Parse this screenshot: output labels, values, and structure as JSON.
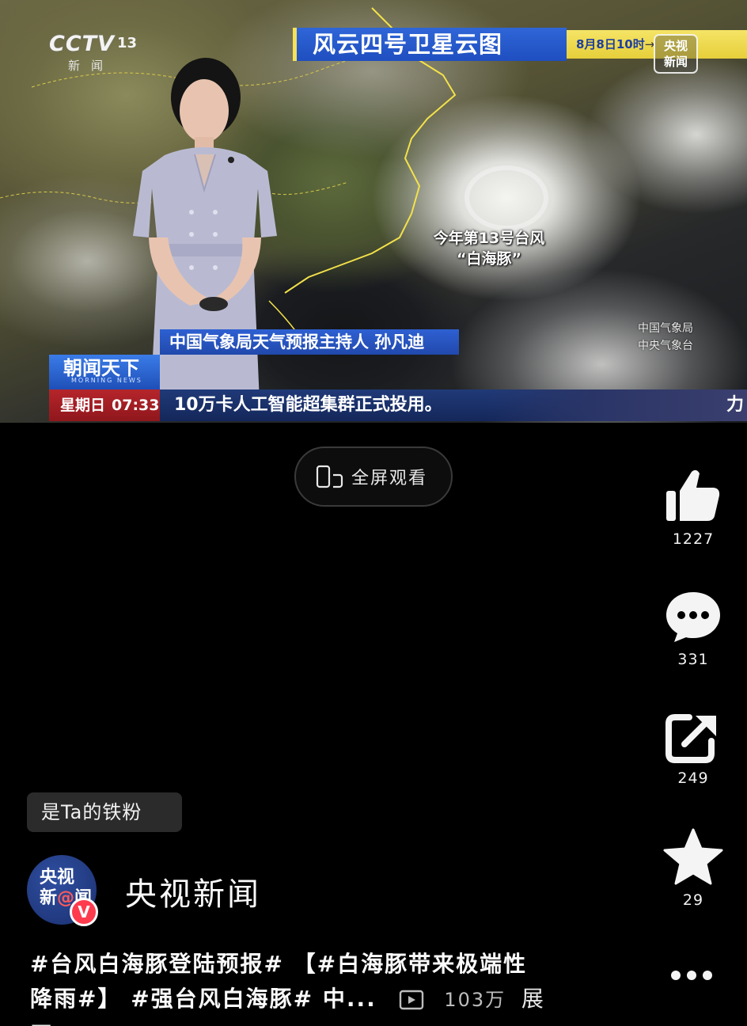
{
  "video": {
    "channel_logo": "CCTV 13",
    "channel_logo_main": "CCTV",
    "channel_logo_num": "13",
    "channel_logo_sub": "新闻",
    "satellite_title": "风云四号卫星云图",
    "date_text": "8月8日10时",
    "date_arrow": "→",
    "logo_line1": "央视",
    "logo_line2": "新闻",
    "typhoon_line1": "今年第13号台风",
    "typhoon_line2": "“白海豚”",
    "cma_line1": "中国气象局",
    "cma_line2": "中央气象台",
    "host_caption": "中国气象局天气预报主持人 孙凡迪",
    "show_name": "朝闻天下",
    "show_name_en": "MORNING NEWS",
    "weekday": "星期日",
    "time": "07:33",
    "ticker": "10万卡人工智能超集群正式投用。",
    "ticker_tail": "力"
  },
  "fullscreen": {
    "label": "全屏观看"
  },
  "actions": {
    "like_count": "1227",
    "comment_count": "331",
    "share_count": "249",
    "favorite_count": "29"
  },
  "fan_badge": "是Ta的铁粉",
  "author": {
    "avatar_line1": "央视",
    "avatar_line2a": "新",
    "avatar_line2b": "闻",
    "verified": "V",
    "name": "央视新闻"
  },
  "caption": {
    "line1": "#台风白海豚登陆预报# 【#白海豚带来极端性",
    "line2": "降雨#】 #强台风白海豚# 中...",
    "views": "103万",
    "expand": "展开"
  }
}
